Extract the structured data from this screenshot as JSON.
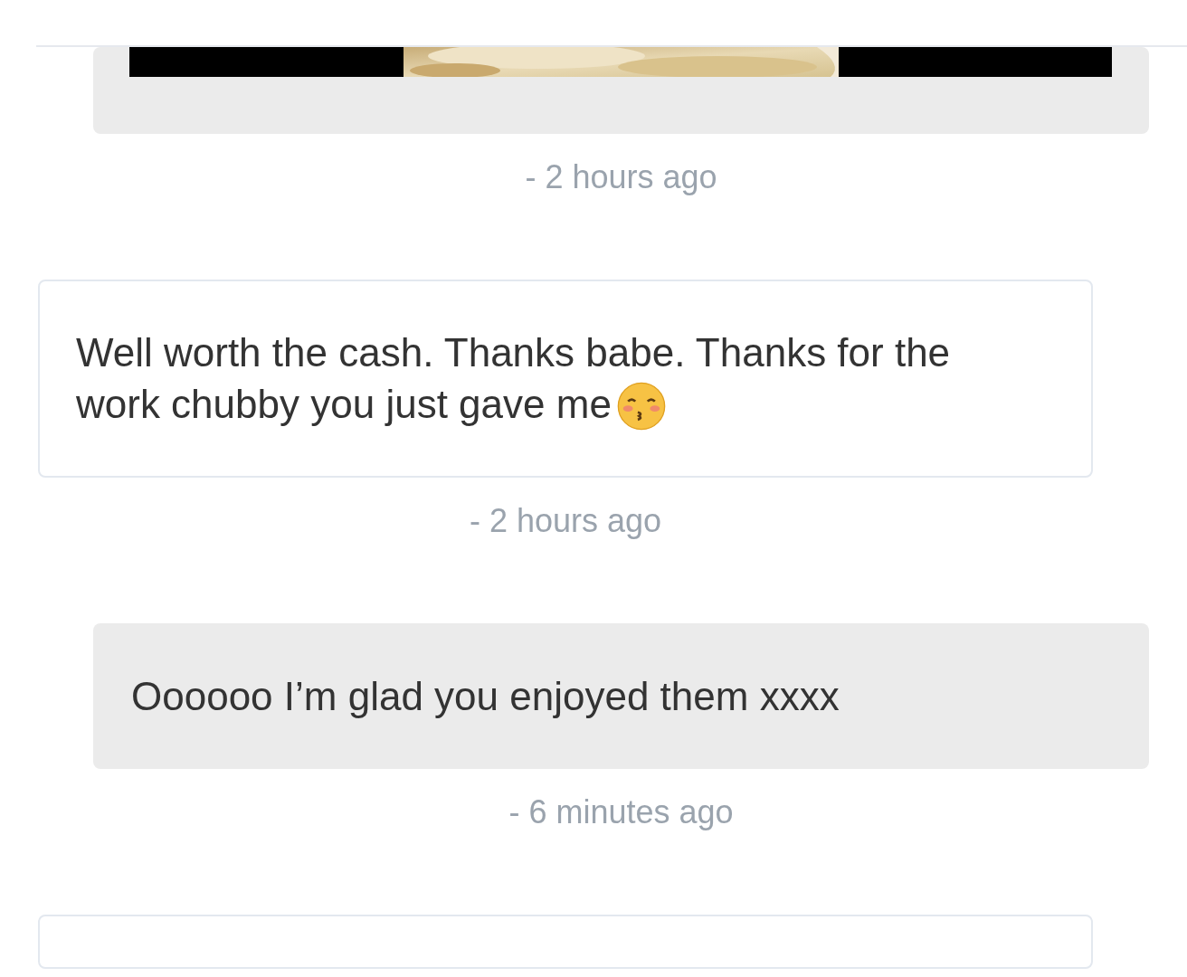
{
  "messages": [
    {
      "kind": "received",
      "time": "- 2 hours ago"
    },
    {
      "kind": "sent",
      "text": "Well worth the cash. Thanks babe. Thanks for the work chubby you just gave me",
      "emoji": true,
      "time": "- 2 hours ago"
    },
    {
      "kind": "received",
      "text": "Oooooo I’m glad you enjoyed them xxxx",
      "time": "- 6 minutes ago"
    },
    {
      "kind": "sent"
    }
  ]
}
